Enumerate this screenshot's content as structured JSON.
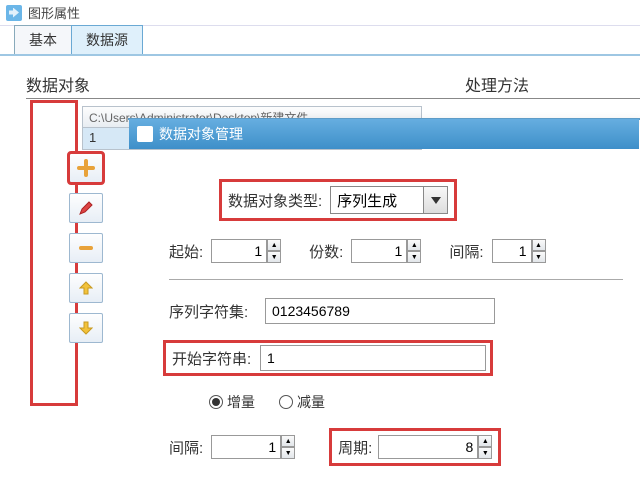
{
  "window": {
    "title": "图形属性"
  },
  "tabs": {
    "basic": "基本",
    "datasource": "数据源"
  },
  "groups": {
    "data_object": "数据对象",
    "method": "处理方法"
  },
  "list": {
    "header": "C:\\Users\\Administrator\\Desktop\\新建文件",
    "row1": "1"
  },
  "dialog": {
    "title": "数据对象管理",
    "type_label": "数据对象类型:",
    "type_value": "序列生成",
    "start_label": "起始:",
    "start_value": "1",
    "copies_label": "份数:",
    "copies_value": "1",
    "interval1_label": "间隔:",
    "interval1_value": "1",
    "charset_label": "序列字符集:",
    "charset_value": "0123456789",
    "startstr_label": "开始字符串:",
    "startstr_value": "1",
    "radio_inc": "增量",
    "radio_dec": "减量",
    "interval2_label": "间隔:",
    "interval2_value": "1",
    "period_label": "周期:",
    "period_value": "8"
  }
}
